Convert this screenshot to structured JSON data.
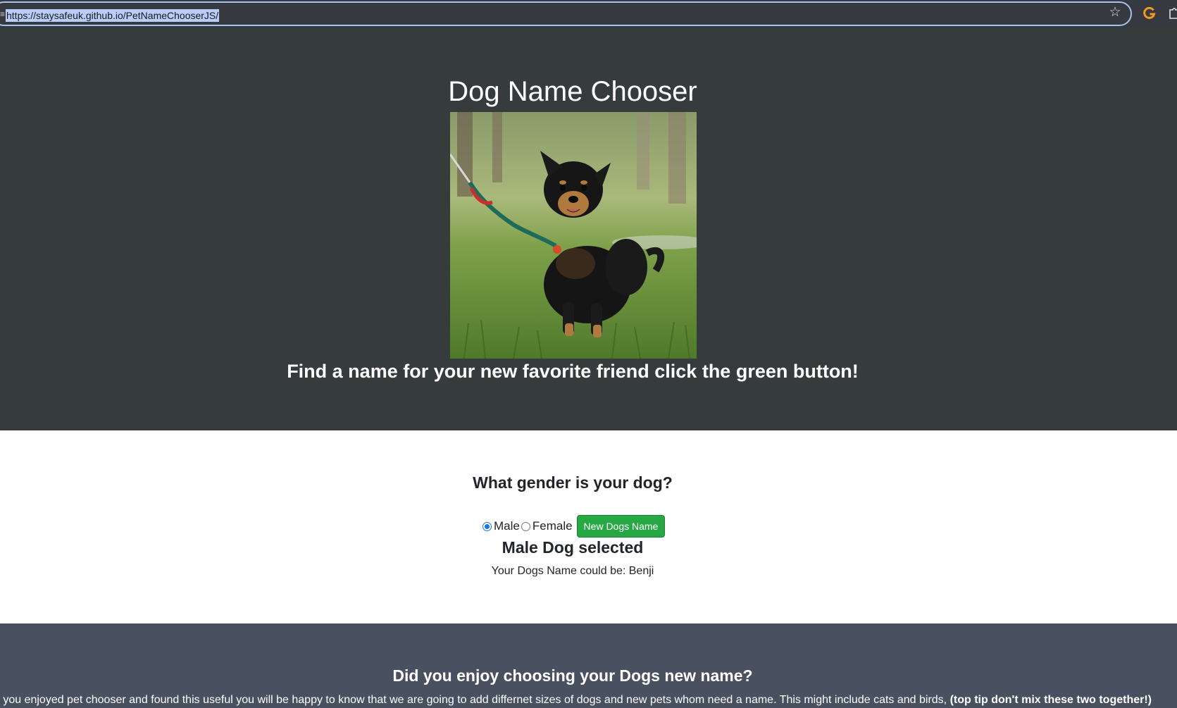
{
  "browser": {
    "url": "https://staysafeuk.github.io/PetNameChooserJS/",
    "icons": {
      "site_info": "site-info-icon",
      "bookmark": "star-icon",
      "extension": "extension-g-icon",
      "extensions_menu": "puzzle-icon"
    },
    "colors": {
      "focus_ring": "#a9c1f2",
      "url_highlight": "#b8cdfa"
    }
  },
  "hero": {
    "title": "Dog Name Chooser",
    "image": "dog-photo",
    "tagline": "Find a name for your new favorite friend click the green button!"
  },
  "chooser": {
    "question": "What gender is your dog?",
    "options": [
      {
        "label": "Male",
        "checked": true
      },
      {
        "label": "Female",
        "checked": false
      }
    ],
    "button_label": "New Dogs Name",
    "selected_status": "Male Dog selected",
    "result": "Your Dogs Name could be: Benji"
  },
  "footer": {
    "heading": "Did you enjoy choosing your Dogs new name?",
    "text": "If you enjoyed pet chooser and found this useful you will be happy to know that we are going to add differnet sizes of dogs and new pets whom need a name. This might include cats and birds, ",
    "tip": "(top tip don't mix these two together!)"
  },
  "colors": {
    "hero_bg": "#363b3c",
    "footer_bg": "#495060",
    "button_green": "#28a745",
    "radio_blue": "#1a73e8"
  }
}
